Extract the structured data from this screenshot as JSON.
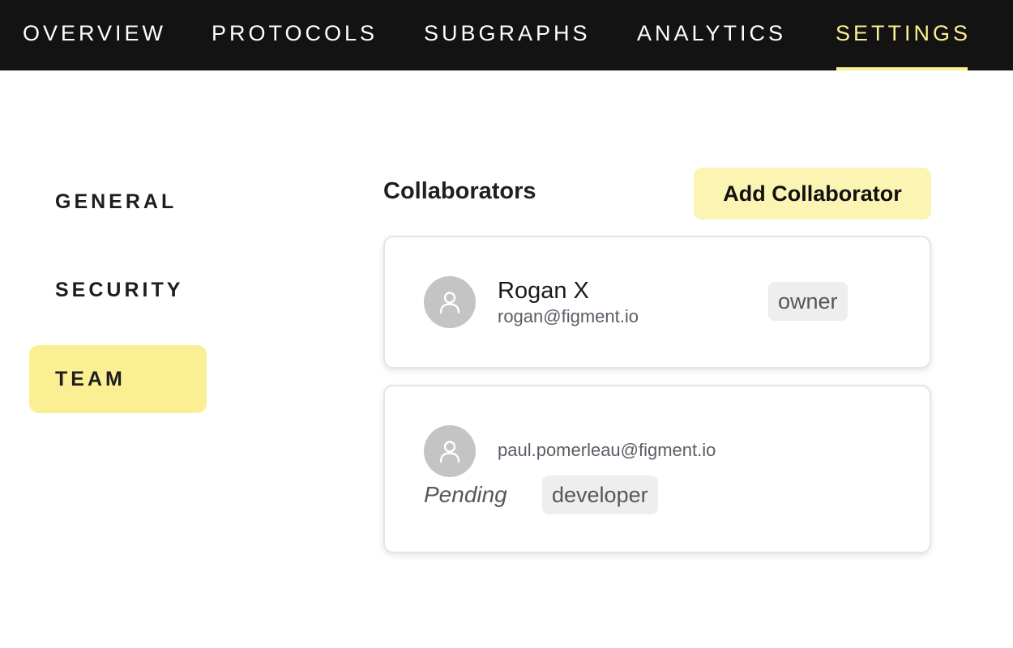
{
  "topnav": {
    "items": [
      {
        "label": "OVERVIEW"
      },
      {
        "label": "PROTOCOLS"
      },
      {
        "label": "SUBGRAPHS"
      },
      {
        "label": "ANALYTICS"
      },
      {
        "label": "SETTINGS",
        "active": true
      }
    ]
  },
  "sidenav": {
    "items": [
      {
        "label": "GENERAL"
      },
      {
        "label": "SECURITY"
      },
      {
        "label": "TEAM",
        "active": true
      }
    ]
  },
  "main": {
    "title": "Collaborators",
    "add_button_label": "Add Collaborator",
    "collaborators": [
      {
        "name": "Rogan X",
        "email": "rogan@figment.io",
        "role": "owner",
        "avatar_icon": "user-icon"
      },
      {
        "name": "",
        "email": "paul.pomerleau@figment.io",
        "status": "Pending",
        "role": "developer",
        "avatar_icon": "user-icon"
      }
    ]
  },
  "colors": {
    "nav_bg": "#131313",
    "accent": "#fbef93",
    "button_bg": "#fcf4b3",
    "badge_bg": "#eeeeee",
    "avatar_bg": "#c4c4c4"
  }
}
